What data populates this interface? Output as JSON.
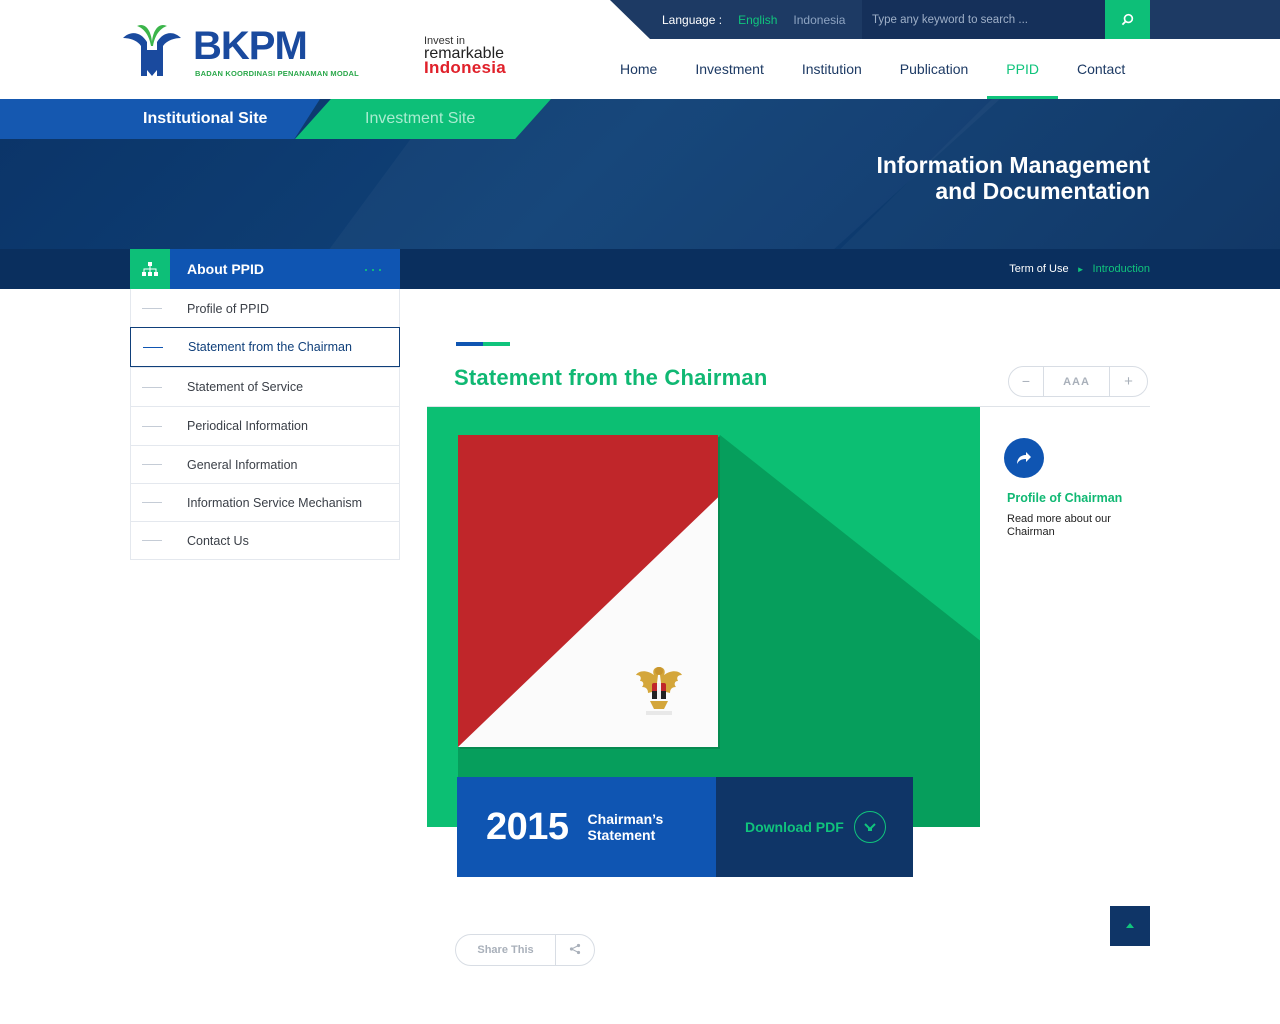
{
  "header": {
    "logo_text": "BKPM",
    "logo_subtitle": "BADAN KOORDINASI PENANAMAN MODAL",
    "invest_line1": "Invest in",
    "invest_line2": "remarkable",
    "invest_line3": "Indonesia",
    "language_label": "Language :",
    "language_en": "English",
    "language_id": "Indonesia",
    "search_placeholder": "Type any keyword to search ...",
    "nav": [
      {
        "label": "Home"
      },
      {
        "label": "Investment"
      },
      {
        "label": "Institution"
      },
      {
        "label": "Publication"
      },
      {
        "label": "PPID"
      },
      {
        "label": "Contact"
      }
    ],
    "active_nav": "PPID"
  },
  "hero": {
    "tab_institutional": "Institutional Site",
    "tab_investment": "Investment Site",
    "title_line1": "Information Management",
    "title_line2": "and Documentation",
    "breadcrumb": [
      {
        "label": "Term of Use"
      },
      {
        "label": "Introduction"
      }
    ]
  },
  "sidebar": {
    "title": "About PPID",
    "more": "···",
    "items": [
      {
        "label": "Profile of PPID"
      },
      {
        "label": "Statement from the Chairman"
      },
      {
        "label": "Statement of Service"
      },
      {
        "label": "Periodical Information"
      },
      {
        "label": "General Information"
      },
      {
        "label": "Information Service Mechanism"
      },
      {
        "label": "Contact Us"
      }
    ],
    "active_item": "Statement from the Chairman"
  },
  "content": {
    "title": "Statement from the Chairman",
    "font_decrease": "−",
    "font_label": "AAA",
    "font_increase": "+",
    "year": "2015",
    "statement_line1": "Chairman’s",
    "statement_line2": "Statement",
    "download_label": "Download PDF",
    "profile_title": "Profile of Chairman",
    "profile_desc": "Read more about our Chairman",
    "share_label": "Share This"
  },
  "colors": {
    "navy": "#0f3567",
    "blue": "#0f55b2",
    "green": "#10c47c",
    "red": "#c0262a"
  },
  "icons": {
    "search": "search-icon",
    "sitemap": "sitemap-icon",
    "arrow": "share-arrow-icon",
    "download": "download-icon",
    "share": "share-icon",
    "top": "back-to-top-icon"
  }
}
